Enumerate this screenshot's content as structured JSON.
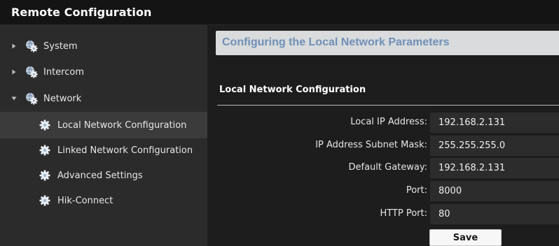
{
  "window": {
    "title": "Remote Configuration"
  },
  "sidebar": {
    "items": [
      {
        "label": "System",
        "expanded": false,
        "icon": "gear-globe-icon"
      },
      {
        "label": "Intercom",
        "expanded": false,
        "icon": "gear-globe-icon"
      },
      {
        "label": "Network",
        "expanded": true,
        "icon": "gear-globe-icon"
      }
    ],
    "network_children": [
      {
        "label": "Local Network Configuration",
        "selected": true,
        "icon": "gear-icon"
      },
      {
        "label": "Linked Network Configuration",
        "selected": false,
        "icon": "gear-icon"
      },
      {
        "label": "Advanced Settings",
        "selected": false,
        "icon": "gear-icon"
      },
      {
        "label": "Hik-Connect",
        "selected": false,
        "icon": "gear-icon"
      }
    ]
  },
  "main": {
    "banner": "Configuring the Local Network Parameters",
    "group_title": "Local Network Configuration",
    "fields": [
      {
        "label": "Local IP Address:",
        "value": "192.168.2.131"
      },
      {
        "label": "IP Address Subnet Mask:",
        "value": "255.255.255.0"
      },
      {
        "label": "Default Gateway:",
        "value": "192.168.2.131"
      },
      {
        "label": "Port:",
        "value": "8000"
      },
      {
        "label": "HTTP Port:",
        "value": "80"
      }
    ],
    "save_label": "Save"
  },
  "colors": {
    "background": "#1d1d1d",
    "sidebar": "#2b2b2b",
    "selected_item": "#3b3b3b",
    "banner_bg": "#d9dbdc",
    "banner_text": "#6f90b6"
  }
}
